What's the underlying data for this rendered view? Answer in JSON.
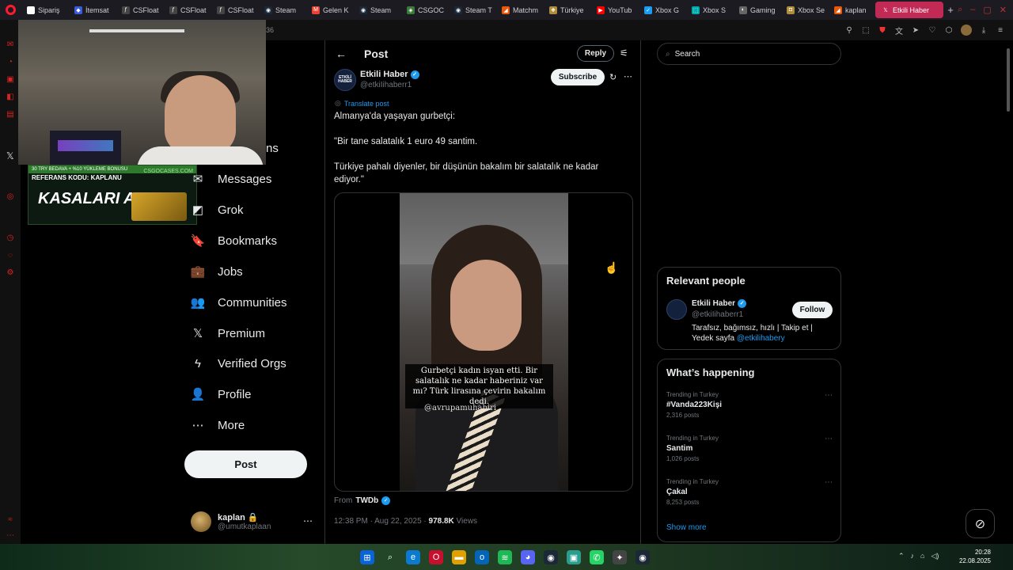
{
  "browser": {
    "tabs": [
      {
        "label": "Sipariş",
        "color": "#ffffff",
        "glyph": "a"
      },
      {
        "label": "İtemsat",
        "color": "#3b5bdb",
        "glyph": "◆"
      },
      {
        "label": "CSFloat",
        "color": "#444444",
        "glyph": "ƒ"
      },
      {
        "label": "CSFloat",
        "color": "#444444",
        "glyph": "ƒ"
      },
      {
        "label": "CSFloat",
        "color": "#444444",
        "glyph": "ƒ"
      },
      {
        "label": "Steam",
        "color": "#1b2838",
        "glyph": "◉"
      },
      {
        "label": "Gelen K",
        "color": "#ea4335",
        "glyph": "M"
      },
      {
        "label": "Steam",
        "color": "#1b2838",
        "glyph": "◉"
      },
      {
        "label": "CSGOC",
        "color": "#3a7a3a",
        "glyph": "◈"
      },
      {
        "label": "Steam T",
        "color": "#1b2838",
        "glyph": "◉"
      },
      {
        "label": "Matchm",
        "color": "#e8590c",
        "glyph": "◢"
      },
      {
        "label": "Türkiye",
        "color": "#b08d3a",
        "glyph": "❖"
      },
      {
        "label": "YouTub",
        "color": "#ff0000",
        "glyph": "▶"
      },
      {
        "label": "Xbox G",
        "color": "#1d9bf0",
        "glyph": "✓"
      },
      {
        "label": "Xbox S",
        "color": "#0aa",
        "glyph": "⬚"
      },
      {
        "label": "Gaming",
        "color": "#666",
        "glyph": "◐"
      },
      {
        "label": "Xbox Se",
        "color": "#b08d3a",
        "glyph": "◘"
      },
      {
        "label": "kaplan",
        "color": "#e8590c",
        "glyph": "◢"
      }
    ],
    "active_tab": {
      "label": "Etkili Haber",
      "glyph": "𝕏"
    },
    "url_fragment": "36"
  },
  "webcam_ad": {
    "top_line": "30 TRY BEDAVA + %10 YÜKLEME BONUSU",
    "ref_line": "REFERANS KODU: KAPLANU",
    "brand": "CSGOCASES.COM",
    "big_text": "KASALARI AÇ"
  },
  "nav": {
    "partial_item": "ns",
    "items": [
      {
        "label": "Messages",
        "icon": "✉",
        "name": "messages"
      },
      {
        "label": "Grok",
        "icon": "◩",
        "name": "grok"
      },
      {
        "label": "Bookmarks",
        "icon": "🔖",
        "name": "bookmarks"
      },
      {
        "label": "Jobs",
        "icon": "💼",
        "name": "jobs"
      },
      {
        "label": "Communities",
        "icon": "👥",
        "name": "communities"
      },
      {
        "label": "Premium",
        "icon": "𝕏",
        "name": "premium"
      },
      {
        "label": "Verified Orgs",
        "icon": "ϟ",
        "name": "verified-orgs"
      },
      {
        "label": "Profile",
        "icon": "👤",
        "name": "profile"
      },
      {
        "label": "More",
        "icon": "⋯",
        "name": "more"
      }
    ],
    "post_button": "Post",
    "account": {
      "name": "kaplan 🔒",
      "handle": "@umutkaplaan"
    }
  },
  "post": {
    "header_title": "Post",
    "reply_label": "Reply",
    "author": {
      "name": "Etkili Haber",
      "handle": "@etkiIihaberr1",
      "avatar_text": "ETKİLİ HABER"
    },
    "subscribe_label": "Subscribe",
    "translate_label": "Translate post",
    "text": [
      "Almanya'da yaşayan gurbetçi:",
      "\"Bir tane salatalık 1 euro 49 santim.",
      "Türkiye pahalı diyenler, bir düşünün bakalım bir salatalık ne kadar ediyor.\""
    ],
    "video_caption": "Gurbetçi kadın isyan etti. Bir salatalık ne kadar haberiniz var mı? Türk lirasına çevirin bakalım dedi.",
    "video_watermark": "@avrupamuhabiri",
    "from_prefix": "From",
    "from_source": "TWDb",
    "time": "12:38 PM · Aug 22, 2025 · ",
    "views_count": "978.8K",
    "views_label": " Views"
  },
  "right": {
    "search_placeholder": "Search",
    "relevant_title": "Relevant people",
    "person": {
      "name": "Etkili Haber",
      "handle": "@etkiIihaberr1",
      "follow_label": "Follow",
      "bio": "Tarafsız, bağımsız, hızlı | Takip et | Yedek sayfa ",
      "bio_link": "@etkilihabery"
    },
    "happening_title": "What’s happening",
    "trends": [
      {
        "context": "Trending in Turkey",
        "name": "#Vanda223Kişi",
        "count": "2,316 posts"
      },
      {
        "context": "Trending in Turkey",
        "name": "Santim",
        "count": "1,026 posts"
      },
      {
        "context": "Trending in Turkey",
        "name": "Çakal",
        "count": "8,253 posts"
      }
    ],
    "show_more": "Show more"
  },
  "taskbar": {
    "time": "20:28",
    "date": "22.08.2025"
  },
  "colors": {
    "accent": "#1d9bf0",
    "background": "#000000",
    "opera_red": "#ff1b2d",
    "active_tab": "#c22a55"
  }
}
